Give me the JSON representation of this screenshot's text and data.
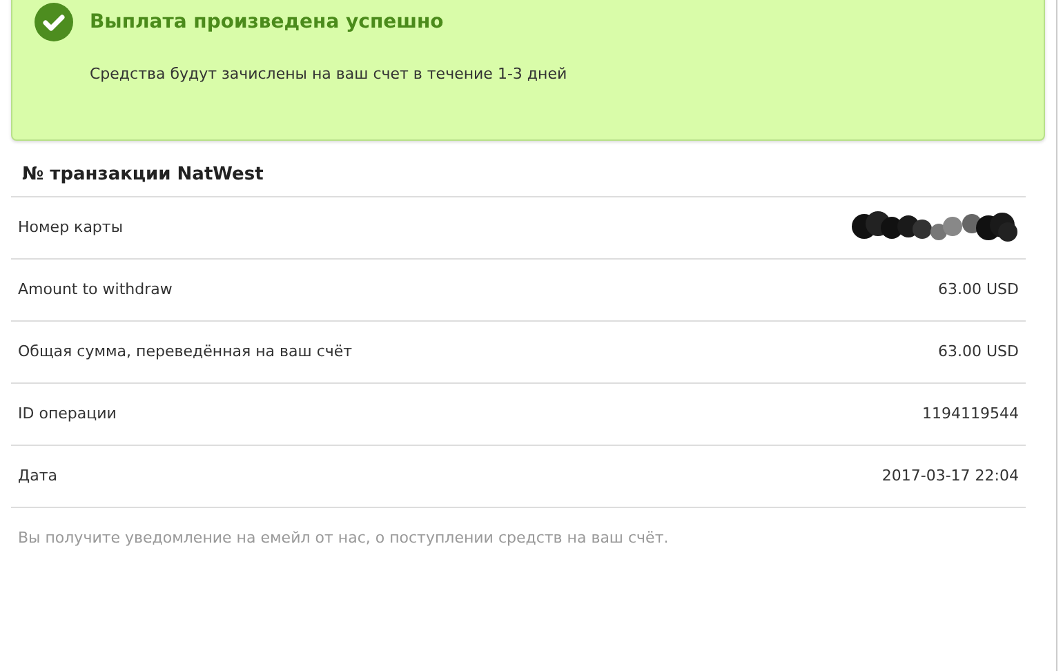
{
  "alert": {
    "title": "Выплата произведена успешно",
    "message": "Средства будут зачислены на ваш счет в течение 1-3 дней"
  },
  "details": {
    "heading": "№ транзакции NatWest",
    "rows": [
      {
        "label": "Номер карты",
        "kind": "redacted"
      },
      {
        "label": "Amount to withdraw",
        "kind": "text",
        "value": "63.00 USD"
      },
      {
        "label": "Общая сумма, переведённая на ваш счёт",
        "kind": "text",
        "value": "63.00 USD"
      },
      {
        "label": "ID операции",
        "kind": "text",
        "value": "1194119544"
      },
      {
        "label": "Дата",
        "kind": "text",
        "value": "2017-03-17 22:04"
      }
    ]
  },
  "note": "Вы получите уведомление на емейл от нас, о поступлении средств на ваш счёт."
}
